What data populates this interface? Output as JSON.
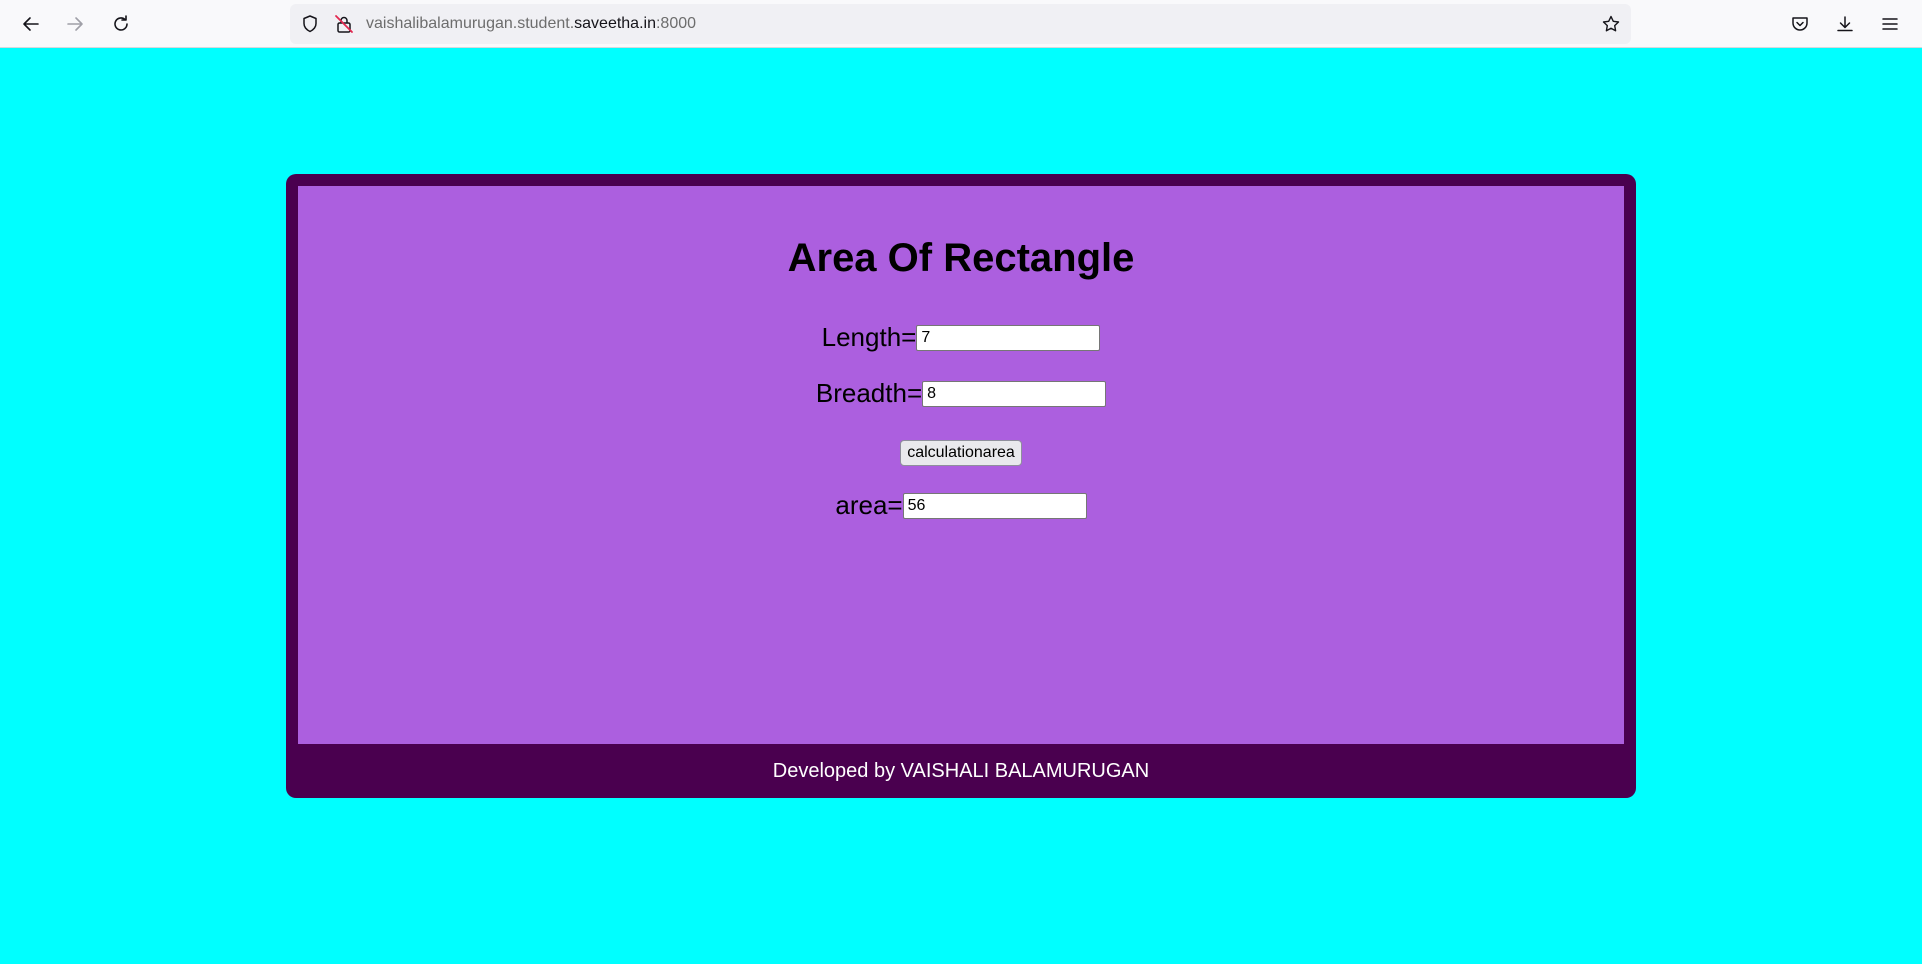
{
  "browser": {
    "url_prefix": "vaishalibalamurugan.student.",
    "url_domain": "saveetha.in",
    "url_suffix": ":8000",
    "icons": {
      "back": "arrow-left-icon",
      "forward": "arrow-right-icon",
      "reload": "reload-icon",
      "tracking": "shield-icon",
      "insecure": "insecure-lock-icon",
      "bookmark": "star-icon",
      "pocket": "pocket-icon",
      "downloads": "download-icon",
      "menu": "hamburger-menu-icon"
    }
  },
  "page": {
    "title": "Area Of Rectangle",
    "length_label": "Length=",
    "length_value": "7",
    "breadth_label": "Breadth=",
    "breadth_value": "8",
    "calculate_label": "calculationarea",
    "area_label": "area=",
    "area_value": "56",
    "footer": "Developed by VAISHALI BALAMURUGAN"
  },
  "colors": {
    "page_background": "#00ffff",
    "container_border": "#4a004f",
    "content_background": "#ac5fdf",
    "footer_text": "#ffffff"
  }
}
